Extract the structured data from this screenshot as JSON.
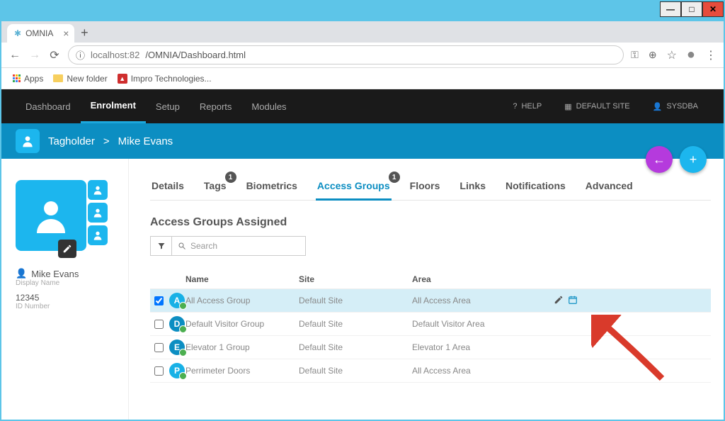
{
  "window": {
    "tab_title": "OMNIA"
  },
  "browser": {
    "url_host": "localhost:82",
    "url_path": "/OMNIA/Dashboard.html",
    "bookmarks": {
      "apps": "Apps",
      "newfolder": "New folder",
      "impro": "Impro Technologies..."
    }
  },
  "topnav": {
    "dashboard": "Dashboard",
    "enrolment": "Enrolment",
    "setup": "Setup",
    "reports": "Reports",
    "modules": "Modules",
    "help": "HELP",
    "site": "DEFAULT SITE",
    "user": "SYSDBA"
  },
  "breadcrumb": {
    "root": "Tagholder",
    "sep": ">",
    "current": "Mike Evans"
  },
  "sidebar": {
    "name": "Mike Evans",
    "name_label": "Display Name",
    "id": "12345",
    "id_label": "ID Number"
  },
  "tabs": {
    "details": "Details",
    "tags": "Tags",
    "tags_badge": "1",
    "biometrics": "Biometrics",
    "access_groups": "Access Groups",
    "access_groups_badge": "1",
    "floors": "Floors",
    "links": "Links",
    "notifications": "Notifications",
    "advanced": "Advanced"
  },
  "section": {
    "title": "Access Groups Assigned",
    "search_placeholder": "Search"
  },
  "grid": {
    "headers": {
      "name": "Name",
      "site": "Site",
      "area": "Area"
    },
    "rows": [
      {
        "checked": true,
        "letter": "A",
        "color": "#18b1e6",
        "name": "All Access Group",
        "site": "Default Site",
        "area": "All Access Area",
        "actions": true
      },
      {
        "checked": false,
        "letter": "D",
        "color": "#0c8ec2",
        "name": "Default Visitor Group",
        "site": "Default Site",
        "area": "Default Visitor Area",
        "actions": false
      },
      {
        "checked": false,
        "letter": "E",
        "color": "#0c8ec2",
        "name": "Elevator 1 Group",
        "site": "Default Site",
        "area": "Elevator 1 Area",
        "actions": false
      },
      {
        "checked": false,
        "letter": "P",
        "color": "#18b1e6",
        "name": "Perrimeter Doors",
        "site": "Default Site",
        "area": "All Access Area",
        "actions": false
      }
    ]
  }
}
